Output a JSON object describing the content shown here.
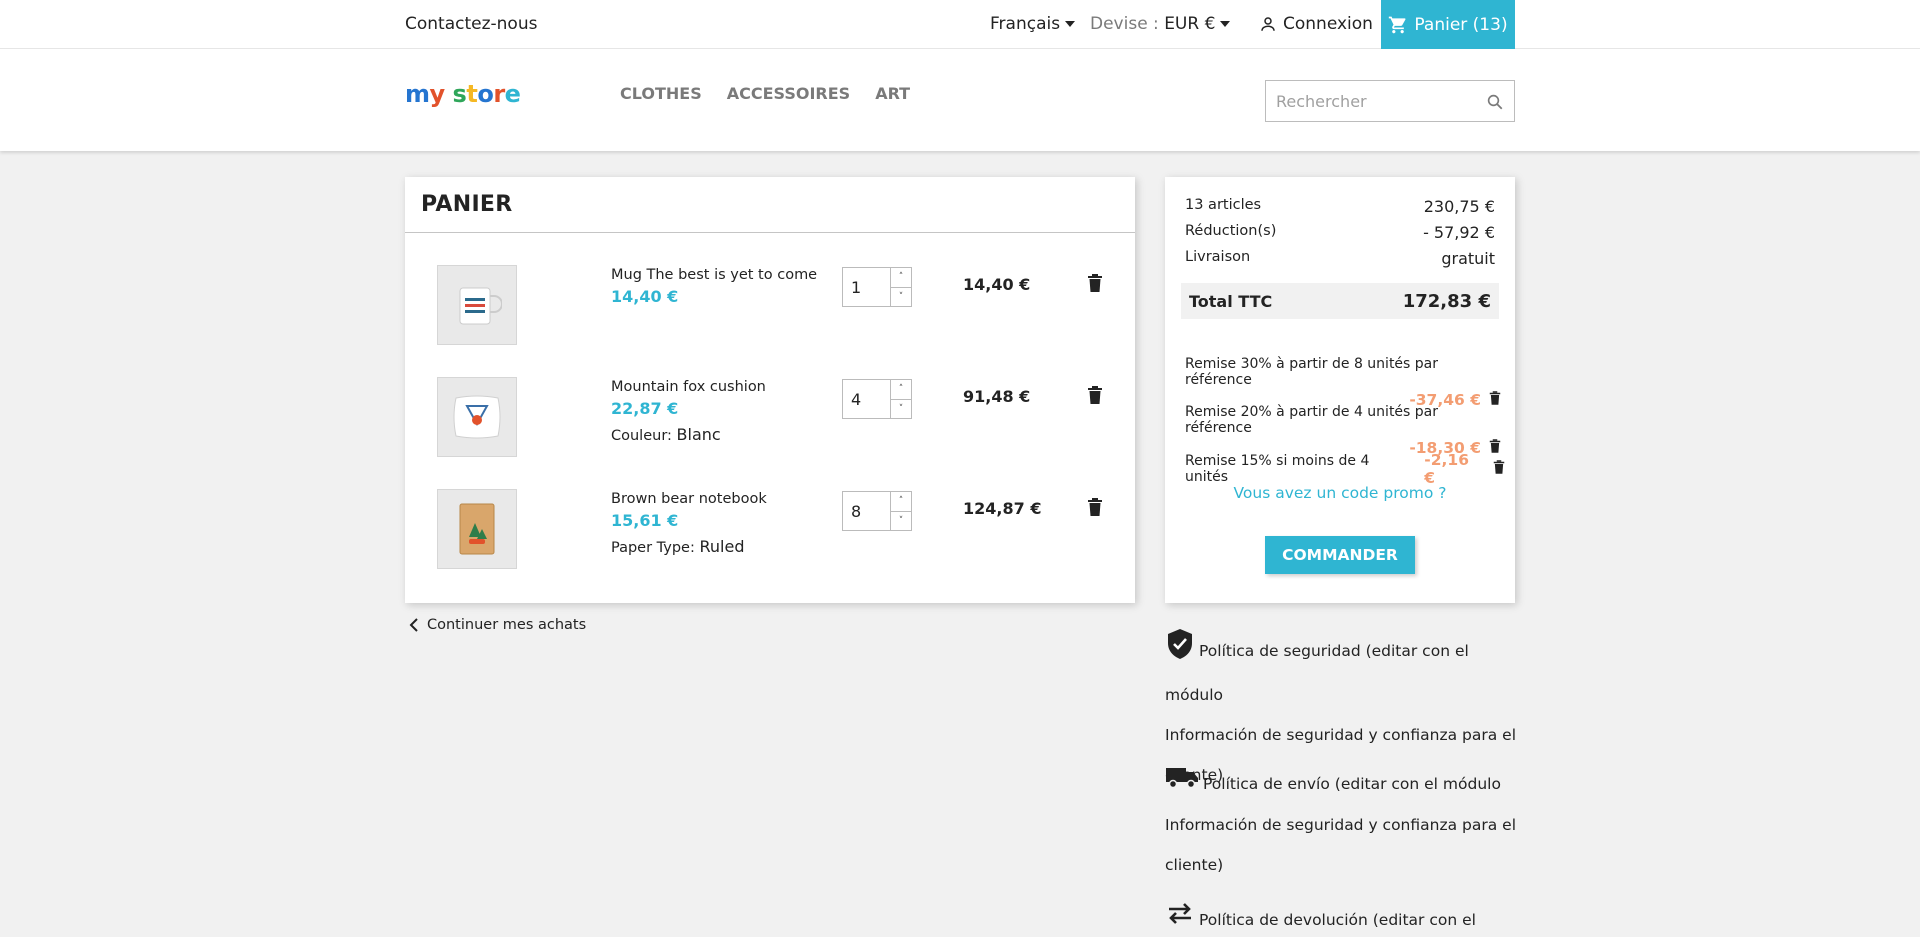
{
  "header": {
    "contact": "Contactez-nous",
    "language": "Français",
    "currency_label": "Devise :",
    "currency_value": "EUR €",
    "login": "Connexion",
    "cart": "Panier (13)"
  },
  "logo": {
    "text": "my store"
  },
  "menu": [
    "CLOTHES",
    "ACCESSOIRES",
    "ART"
  ],
  "search": {
    "placeholder": "Rechercher"
  },
  "cart": {
    "title": "PANIER",
    "items": [
      {
        "name": "Mug The best is yet to come",
        "price": "14,40 €",
        "qty": "1",
        "total": "14,40 €",
        "attr_label": "",
        "attr_value": ""
      },
      {
        "name": "Mountain fox cushion",
        "price": "22,87 €",
        "qty": "4",
        "total": "91,48 €",
        "attr_label": "Couleur:",
        "attr_value": "Blanc"
      },
      {
        "name": "Brown bear notebook",
        "price": "15,61 €",
        "qty": "8",
        "total": "124,87 €",
        "attr_label": "Paper Type:",
        "attr_value": "Ruled"
      }
    ],
    "continue": "Continuer mes achats"
  },
  "summary": {
    "articles_label": "13 articles",
    "articles_value": "230,75 €",
    "reduction_label": "Réduction(s)",
    "reduction_value": "- 57,92 €",
    "shipping_label": "Livraison",
    "shipping_value": "gratuit",
    "total_label": "Total TTC",
    "total_value": "172,83 €",
    "discounts": [
      {
        "label": "Remise 30% à partir de 8 unités par référence",
        "amount": "-37,46 €"
      },
      {
        "label": "Remise 20% à partir de 4 unités par référence",
        "amount": "-18,30 €"
      },
      {
        "label": "Remise 15% si moins de 4 unités",
        "amount": "-2,16 €"
      }
    ],
    "promo": "Vous avez un code promo ?",
    "order_button": "COMMANDER"
  },
  "reassurance": [
    {
      "icon": "shield-check-icon",
      "lines": [
        "Política de seguridad (editar con el módulo",
        "Información de seguridad y confianza para el",
        "cliente)"
      ]
    },
    {
      "icon": "truck-icon",
      "lines": [
        "Política de envío (editar con el módulo",
        "Información de seguridad y confianza para el",
        "cliente)"
      ]
    },
    {
      "icon": "swap-arrows-icon",
      "lines": [
        "Política de devolución (editar con el módulo"
      ]
    }
  ],
  "colors": {
    "accent": "#2fb5d2",
    "discount": "#f39d72",
    "background": "#f1f1f1"
  }
}
